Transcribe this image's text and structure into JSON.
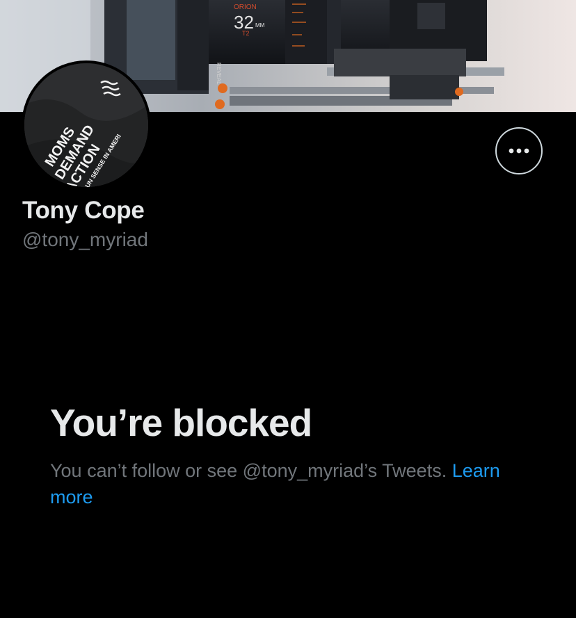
{
  "profile": {
    "display_name": "Tony Cope",
    "handle": "@tony_myriad",
    "avatar": {
      "icon": "avatar-image",
      "text_lines": [
        "MOMS",
        "DEMAND",
        "ACTION",
        "FOR GUN SENSE IN AMERI"
      ]
    },
    "banner": {
      "icon": "camera-banner-image",
      "lens_text": [
        "ORION",
        "32",
        "MM",
        "T2",
        "REVEAL"
      ]
    }
  },
  "actions": {
    "more_icon": "more-options-icon"
  },
  "blocked": {
    "title": "You’re blocked",
    "message": "You can’t follow or see @tony_myriad’s Tweets.",
    "link_label": "Learn more"
  },
  "colors": {
    "background": "#000000",
    "primary_text": "#e7e9ea",
    "secondary_text": "#71767b",
    "link": "#1d9bf0",
    "button_border": "#cfd9de"
  }
}
